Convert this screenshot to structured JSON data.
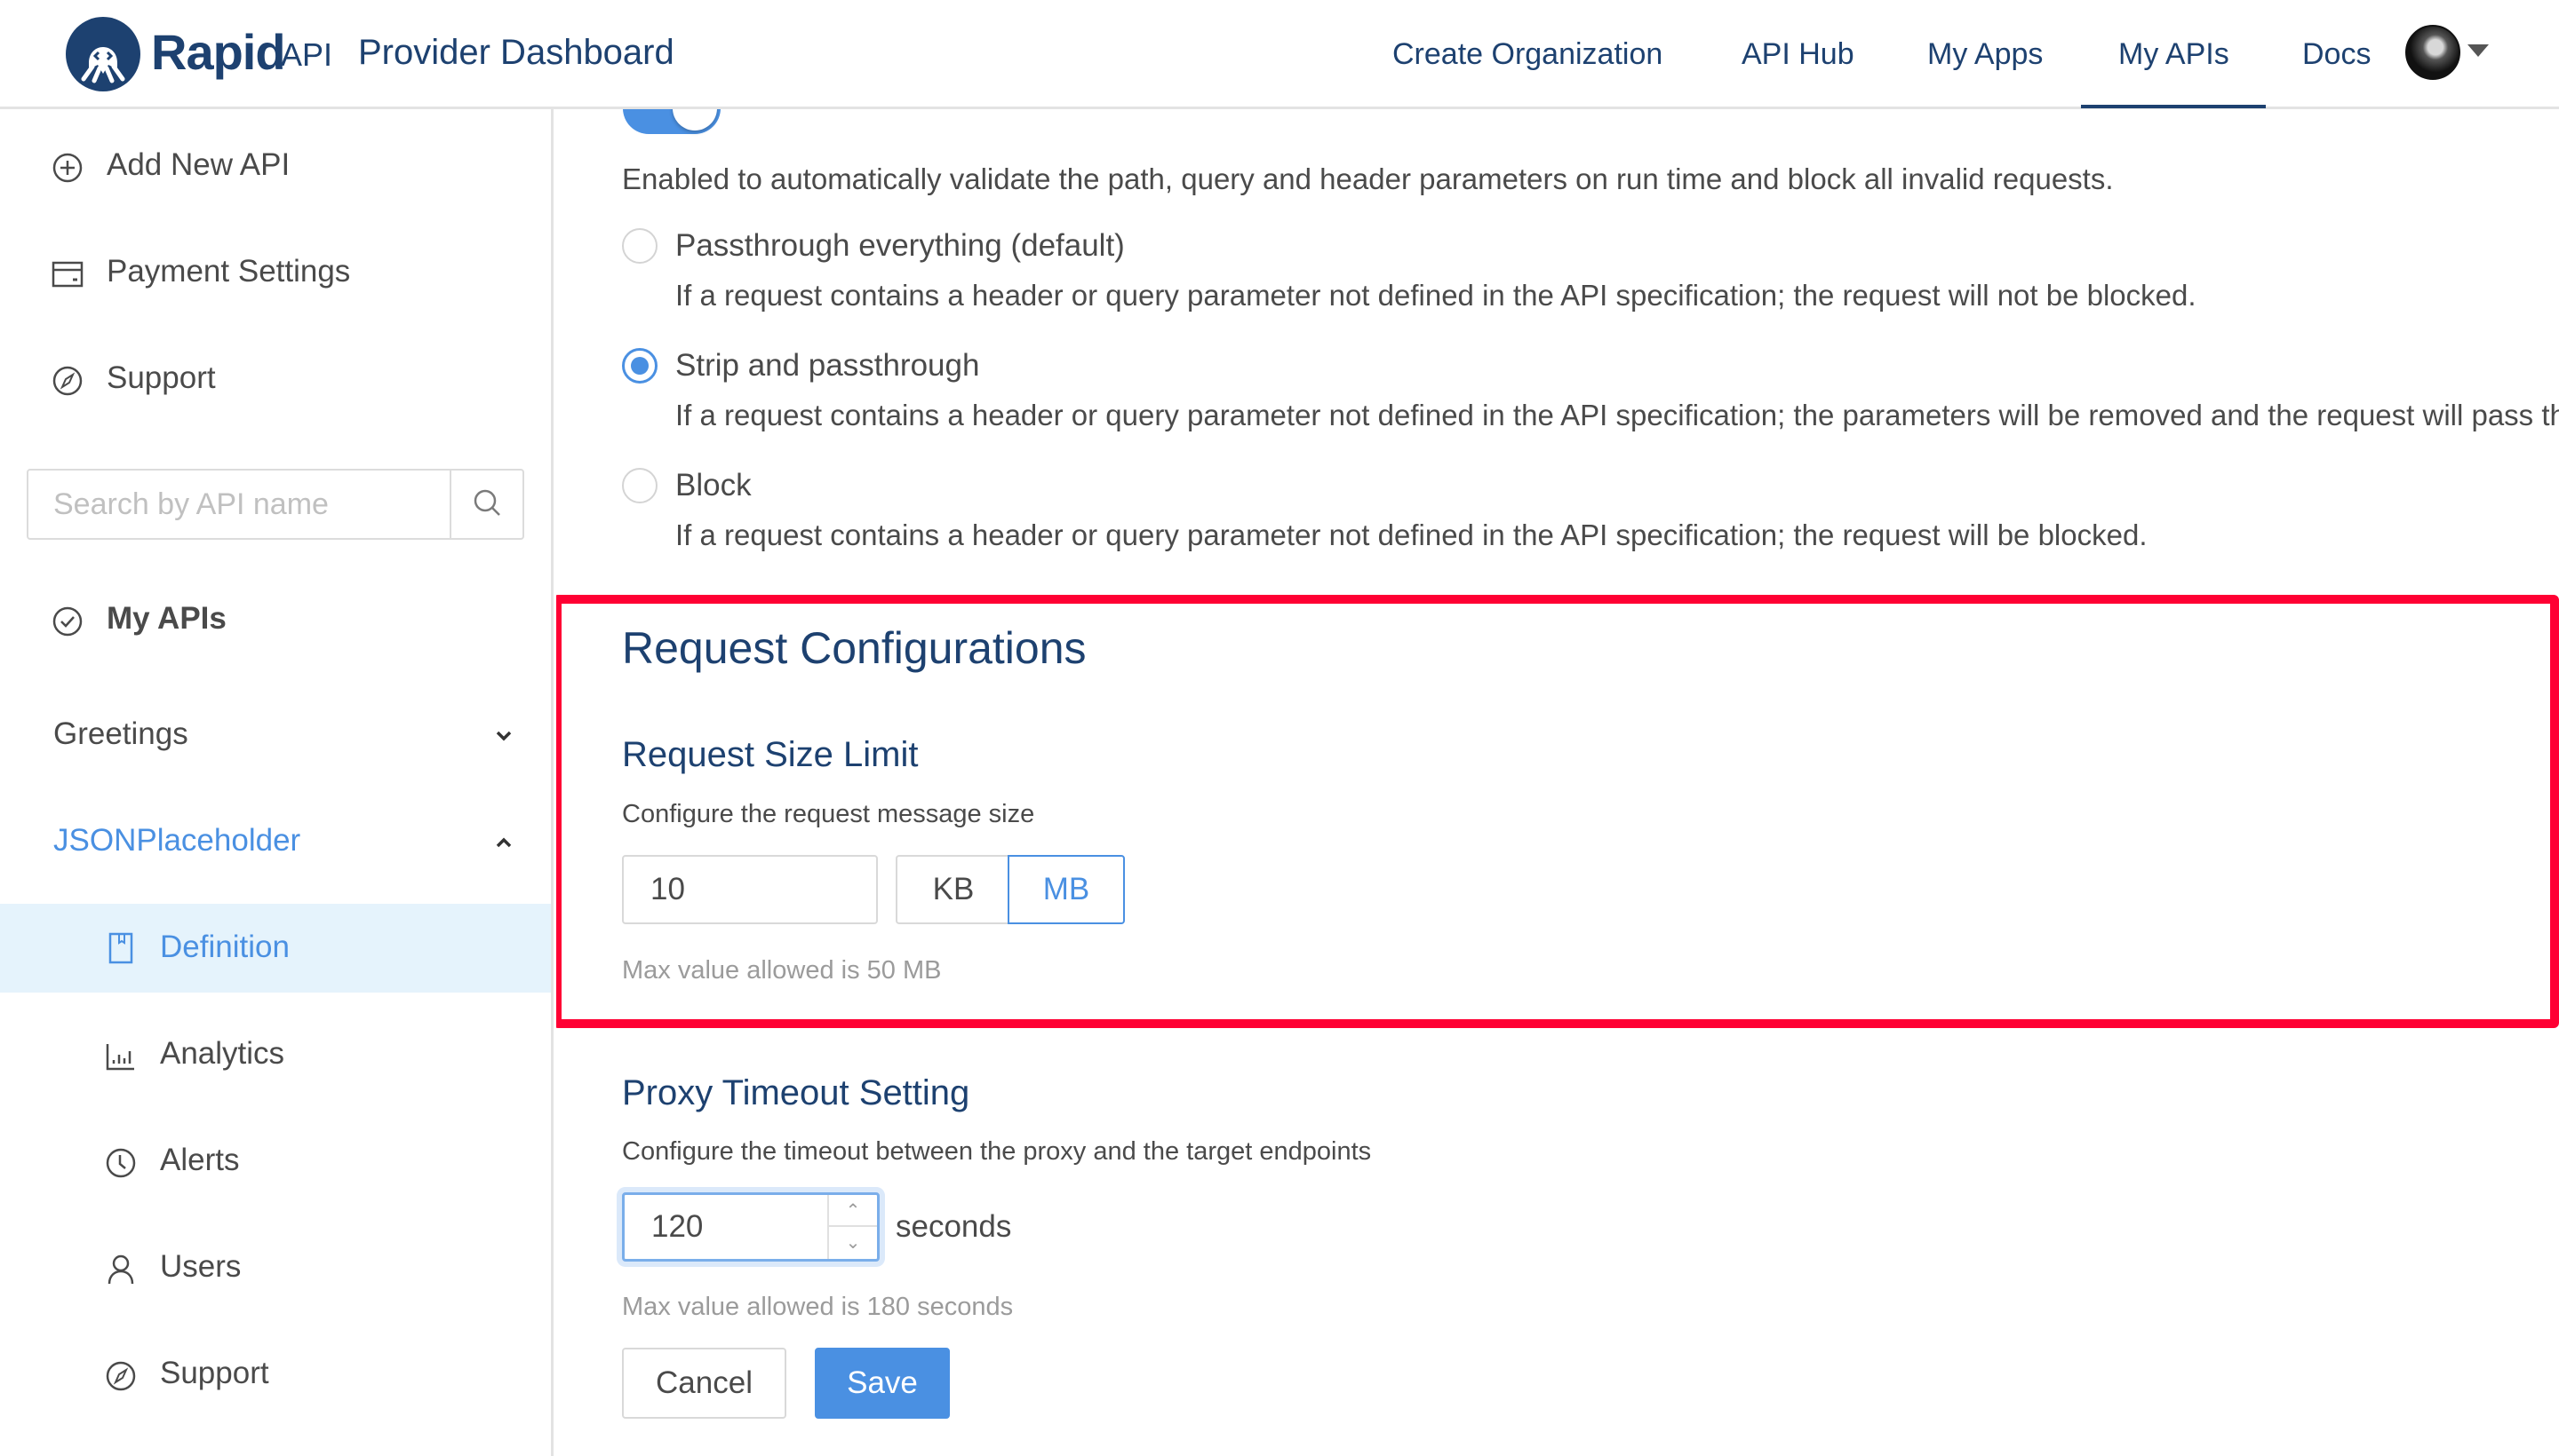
{
  "header": {
    "brand_name": "Rapid",
    "brand_suffix": "API",
    "subtitle": "Provider Dashboard",
    "nav": [
      {
        "label": "Create Organization",
        "active": false
      },
      {
        "label": "API Hub",
        "active": false
      },
      {
        "label": "My Apps",
        "active": false
      },
      {
        "label": "My APIs",
        "active": true
      },
      {
        "label": "Docs",
        "active": false
      }
    ],
    "avatar_icon": "user-avatar",
    "caret_icon": "caret-down-icon"
  },
  "sidebar": {
    "top_items": [
      {
        "label": "Add New API",
        "icon": "plus-circle-icon"
      },
      {
        "label": "Payment Settings",
        "icon": "credit-card-icon"
      },
      {
        "label": "Support",
        "icon": "compass-icon"
      }
    ],
    "search": {
      "placeholder": "Search by API name",
      "value": "",
      "icon": "search-icon"
    },
    "my_apis": {
      "label": "My APIs",
      "icon": "check-circle-icon"
    },
    "apis": [
      {
        "label": "Greetings",
        "expanded": false,
        "icon": "chevron-down-icon"
      },
      {
        "label": "JSONPlaceholder",
        "expanded": true,
        "icon": "chevron-up-icon"
      }
    ],
    "sub_items": [
      {
        "label": "Definition",
        "icon": "book-icon",
        "active": true
      },
      {
        "label": "Analytics",
        "icon": "bar-chart-icon",
        "active": false
      },
      {
        "label": "Alerts",
        "icon": "clock-icon",
        "active": false
      },
      {
        "label": "Users",
        "icon": "user-icon",
        "active": false
      },
      {
        "label": "Support",
        "icon": "compass-icon",
        "active": false
      }
    ]
  },
  "main": {
    "validation": {
      "toggle_on": true,
      "description": "Enabled to automatically validate the path, query and header parameters on run time and block all invalid requests.",
      "options": [
        {
          "label": "Passthrough everything (default)",
          "checked": false,
          "description": "If a request contains a header or query parameter not defined in the API specification; the request will not be blocked."
        },
        {
          "label": "Strip and passthrough",
          "checked": true,
          "description": "If a request contains a header or query parameter not defined in the API specification; the parameters will be removed and the request will pass through."
        },
        {
          "label": "Block",
          "checked": false,
          "description": "If a request contains a header or query parameter not defined in the API specification; the request will be blocked."
        }
      ]
    },
    "request_config": {
      "title": "Request Configurations",
      "size_limit": {
        "title": "Request Size Limit",
        "help": "Configure the request message size",
        "value": "10",
        "units": [
          {
            "label": "KB",
            "selected": false
          },
          {
            "label": "MB",
            "selected": true
          }
        ],
        "hint": "Max value allowed is 50 MB"
      },
      "highlight_color": "#ff0033"
    },
    "proxy_timeout": {
      "title": "Proxy Timeout Setting",
      "help": "Configure the timeout between the proxy and the target endpoints",
      "value": "120",
      "unit_label": "seconds",
      "stepper_up": "^",
      "stepper_down": "v",
      "hint": "Max value allowed is 180 seconds"
    },
    "actions": {
      "cancel_label": "Cancel",
      "save_label": "Save"
    }
  },
  "colors": {
    "brand": "#1d4170",
    "accent": "#4a90e2",
    "highlight": "#ff0033",
    "active_bg": "#e5f3fc"
  }
}
